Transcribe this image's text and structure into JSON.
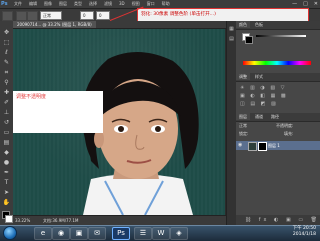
{
  "app": {
    "logo": "Ps",
    "menu": [
      "文件",
      "编辑",
      "图像",
      "图层",
      "类型",
      "选择",
      "滤镜",
      "3D",
      "视图",
      "窗口",
      "帮助"
    ],
    "window_controls": [
      "—",
      "□",
      "✕"
    ]
  },
  "options_bar": {
    "style_label": "正常",
    "width_value": "0",
    "height_value": "0"
  },
  "annotation": {
    "text": "羽化: 30像素 调整色阶 (单击打开...)"
  },
  "document": {
    "tab_label": "20090714... @ 33.2% (图层 1, RGB/8)"
  },
  "canvas": {
    "white_box_text": "调整不透明度"
  },
  "statusbar": {
    "zoom": "33.22%",
    "doc_info": "文档:36.9M/77.1M"
  },
  "panels": {
    "color_tabs": [
      "颜色",
      "色板"
    ],
    "adjust_tabs": [
      "调整",
      "样式"
    ],
    "layers_tabs": [
      "图层",
      "通道",
      "路径"
    ],
    "layer_mode": "正常",
    "opacity_label": "不透明度:",
    "lock_label": "锁定:",
    "fill_label": "填充:",
    "layer_name": "图层 1"
  },
  "taskbar": {
    "time": "下午 20:50",
    "date": "2014/1/18",
    "buttons": [
      "e",
      "◉",
      "▣",
      "✉",
      "Ps",
      "☰",
      "W",
      "◈"
    ]
  },
  "colors": {
    "canvas_bg": "#1f4d48",
    "annotation_red": "#d33333",
    "layer_highlight": "#5b6f8f"
  }
}
